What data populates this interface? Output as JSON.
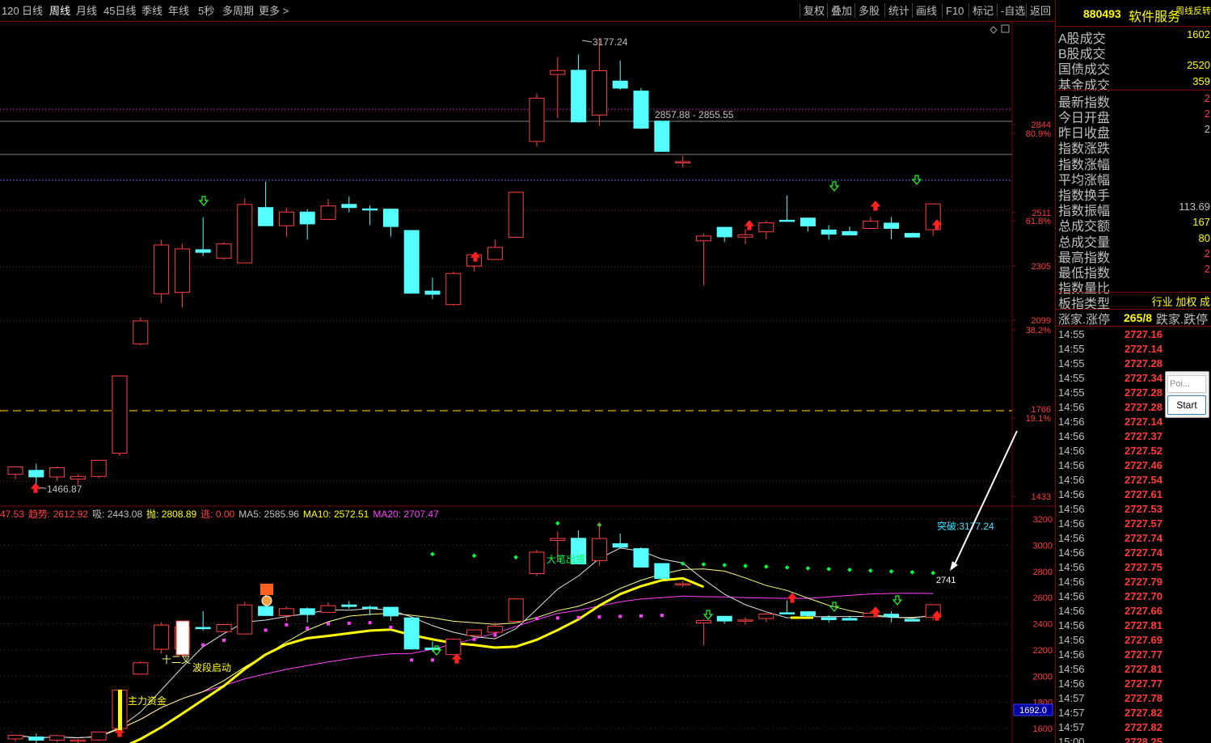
{
  "toolbar": {
    "left": [
      "120",
      "日线",
      "周线",
      "月线",
      "45日线",
      "季线",
      "年线",
      "5秒",
      "多周期",
      "更多 >"
    ],
    "active": "周线",
    "right": [
      "复权",
      "叠加",
      "多股",
      "统计",
      "画线",
      "F10",
      "标记",
      "-自选",
      "返回"
    ]
  },
  "price_axis": {
    "labels": [
      "2844",
      "80.9%",
      "2511",
      "61.8%",
      "2305",
      "2099",
      "38.2%",
      "1766",
      "19.1%",
      "1433"
    ]
  },
  "annotations": {
    "high": "3177.24",
    "low": "1466.87",
    "range_line": "2857.88 - 2855.55"
  },
  "indicator": {
    "legend": [
      {
        "text": "47.53",
        "color": "#ff4040"
      },
      {
        "text": "趋势: 2612.92",
        "color": "#ff4040"
      },
      {
        "text": "吸: 2443.08",
        "color": "#c0c0c0"
      },
      {
        "text": "抛: 2808.89",
        "color": "#ffff00"
      },
      {
        "text": "逃: 0.00",
        "color": "#ff4040"
      },
      {
        "text": "MA5: 2585.96",
        "color": "#c0c0c0"
      },
      {
        "text": "MA10: 2572.51",
        "color": "#ffff00"
      },
      {
        "text": "MA20: 2707.47",
        "color": "#ff40ff"
      }
    ],
    "axis": [
      "3200",
      "3000",
      "2800",
      "2600",
      "2400",
      "2200",
      "2000",
      "1800",
      "1600"
    ],
    "current_value": "1692.0",
    "labels": {
      "breakout": "突破:3177.24",
      "big_order": "大笔出货",
      "main_fund": "主力资金",
      "wave_start": "波段启动",
      "cross": "十二叉",
      "last_value": "2741"
    }
  },
  "panel": {
    "code": "880493",
    "name": "软件服务",
    "subtitle": "周线反转",
    "rows": [
      {
        "label": "A股成交",
        "value": "1602",
        "color": "#ffff00"
      },
      {
        "label": "B股成交",
        "value": "",
        "color": "#ffff00"
      },
      {
        "label": "国债成交",
        "value": "2520",
        "color": "#ffff00"
      },
      {
        "label": "基金成交",
        "value": "359",
        "color": "#ffff00"
      },
      {
        "label": "最新指数",
        "value": "2",
        "color": "#ff3c3c"
      },
      {
        "label": "今日开盘",
        "value": "2",
        "color": "#ff3c3c"
      },
      {
        "label": "昨日收盘",
        "value": "2",
        "color": "#c0c0c0"
      },
      {
        "label": "指数涨跌",
        "value": "",
        "color": "#ff3c3c"
      },
      {
        "label": "指数涨幅",
        "value": "",
        "color": "#ff3c3c"
      },
      {
        "label": "平均涨幅",
        "value": "",
        "color": "#ff3c3c"
      },
      {
        "label": "指数换手",
        "value": "",
        "color": "#ffff00"
      },
      {
        "label": "指数振幅",
        "value": "113.69",
        "color": "#c0c0c0"
      },
      {
        "label": "总成交额",
        "value": "167",
        "color": "#ffff00"
      },
      {
        "label": "总成交量",
        "value": "80",
        "color": "#ffff00"
      },
      {
        "label": "最高指数",
        "value": "2",
        "color": "#ff3c3c"
      },
      {
        "label": "最低指数",
        "value": "2",
        "color": "#ff3c3c"
      },
      {
        "label": "指数量比",
        "value": "",
        "color": "#ffff00"
      }
    ],
    "type_label": "板指类型",
    "type_value": "行业 加权 成",
    "updown_label_a": "涨家.涨停",
    "updown_value": "265/8",
    "updown_label_b": "跌家.跌停",
    "ticks": [
      {
        "time": "14:55",
        "price": "2727.16"
      },
      {
        "time": "14:55",
        "price": "2727.14"
      },
      {
        "time": "14:55",
        "price": "2727.28"
      },
      {
        "time": "14:55",
        "price": "2727.34"
      },
      {
        "time": "14:55",
        "price": "2727.28"
      },
      {
        "time": "14:56",
        "price": "2727.28"
      },
      {
        "time": "14:56",
        "price": "2727.14"
      },
      {
        "time": "14:56",
        "price": "2727.37"
      },
      {
        "time": "14:56",
        "price": "2727.52"
      },
      {
        "time": "14:56",
        "price": "2727.46"
      },
      {
        "time": "14:56",
        "price": "2727.54"
      },
      {
        "time": "14:56",
        "price": "2727.61"
      },
      {
        "time": "14:56",
        "price": "2727.53"
      },
      {
        "time": "14:56",
        "price": "2727.57"
      },
      {
        "time": "14:56",
        "price": "2727.74"
      },
      {
        "time": "14:56",
        "price": "2727.74"
      },
      {
        "time": "14:56",
        "price": "2727.75"
      },
      {
        "time": "14:56",
        "price": "2727.79"
      },
      {
        "time": "14:56",
        "price": "2727.70"
      },
      {
        "time": "14:56",
        "price": "2727.66"
      },
      {
        "time": "14:56",
        "price": "2727.81"
      },
      {
        "time": "14:56",
        "price": "2727.69"
      },
      {
        "time": "14:56",
        "price": "2727.77"
      },
      {
        "time": "14:56",
        "price": "2727.81"
      },
      {
        "time": "14:56",
        "price": "2727.77"
      },
      {
        "time": "14:57",
        "price": "2727.78"
      },
      {
        "time": "14:57",
        "price": "2727.82"
      },
      {
        "time": "14:57",
        "price": "2727.82"
      },
      {
        "time": "15:00",
        "price": "2728.25"
      }
    ]
  },
  "popup": {
    "input_placeholder": "Poi...",
    "button": "Start"
  },
  "chart_data": {
    "type": "candlestick",
    "period": "weekly",
    "price_range": [
      1433,
      3177.24
    ],
    "candles": [
      {
        "o": 1520,
        "h": 1545,
        "l": 1500,
        "c": 1548
      },
      {
        "o": 1535,
        "h": 1560,
        "l": 1467,
        "c": 1510
      },
      {
        "o": 1510,
        "h": 1550,
        "l": 1495,
        "c": 1545
      },
      {
        "o": 1502,
        "h": 1520,
        "l": 1480,
        "c": 1512
      },
      {
        "o": 1512,
        "h": 1575,
        "l": 1505,
        "c": 1573
      },
      {
        "o": 1600,
        "h": 1895,
        "l": 1590,
        "c": 1893
      },
      {
        "o": 2015,
        "h": 2115,
        "l": 2010,
        "c": 2102
      },
      {
        "o": 2205,
        "h": 2410,
        "l": 2170,
        "c": 2390
      },
      {
        "o": 2210,
        "h": 2395,
        "l": 2152,
        "c": 2375
      },
      {
        "o": 2372,
        "h": 2495,
        "l": 2348,
        "c": 2362
      },
      {
        "o": 2340,
        "h": 2400,
        "l": 2335,
        "c": 2394
      },
      {
        "o": 2322,
        "h": 2568,
        "l": 2322,
        "c": 2544
      },
      {
        "o": 2532,
        "h": 2630,
        "l": 2532,
        "c": 2463
      },
      {
        "o": 2463,
        "h": 2532,
        "l": 2420,
        "c": 2515
      },
      {
        "o": 2515,
        "h": 2525,
        "l": 2410,
        "c": 2470
      },
      {
        "o": 2487,
        "h": 2565,
        "l": 2485,
        "c": 2538
      },
      {
        "o": 2544,
        "h": 2574,
        "l": 2514,
        "c": 2532
      },
      {
        "o": 2527,
        "h": 2540,
        "l": 2465,
        "c": 2523
      },
      {
        "o": 2526,
        "h": 2490,
        "l": 2422,
        "c": 2460
      },
      {
        "o": 2445,
        "h": 2425,
        "l": 2213,
        "c": 2207
      },
      {
        "o": 2215,
        "h": 2266,
        "l": 2185,
        "c": 2203
      },
      {
        "o": 2164,
        "h": 2288,
        "l": 2160,
        "c": 2282
      },
      {
        "o": 2310,
        "h": 2334,
        "l": 2290,
        "c": 2353
      },
      {
        "o": 2335,
        "h": 2409,
        "l": 2333,
        "c": 2381
      },
      {
        "o": 2419,
        "h": 2590,
        "l": 2417,
        "c": 2590
      },
      {
        "o": 2783,
        "h": 2965,
        "l": 2764,
        "c": 2947
      },
      {
        "o": 3037,
        "h": 3103,
        "l": 2872,
        "c": 3052
      },
      {
        "o": 3053,
        "h": 3113,
        "l": 2854,
        "c": 2857
      },
      {
        "o": 2883,
        "h": 3177,
        "l": 2842,
        "c": 3051
      },
      {
        "o": 3012,
        "h": 3090,
        "l": 2979,
        "c": 2985
      },
      {
        "o": 2974,
        "h": 2985,
        "l": 2830,
        "c": 2833
      },
      {
        "o": 2860,
        "h": 2860,
        "l": 2744,
        "c": 2745
      },
      {
        "o": 2706,
        "h": 2727,
        "l": 2683,
        "c": 2706
      },
      {
        "o": 2406,
        "h": 2434,
        "l": 2236,
        "c": 2424
      },
      {
        "o": 2457,
        "h": 2440,
        "l": 2401,
        "c": 2421
      },
      {
        "o": 2420,
        "h": 2450,
        "l": 2393,
        "c": 2429
      },
      {
        "o": 2440,
        "h": 2481,
        "l": 2411,
        "c": 2474
      },
      {
        "o": 2484,
        "h": 2578,
        "l": 2487,
        "c": 2480
      },
      {
        "o": 2492,
        "h": 2480,
        "l": 2441,
        "c": 2462
      },
      {
        "o": 2447,
        "h": 2465,
        "l": 2410,
        "c": 2431
      },
      {
        "o": 2441,
        "h": 2460,
        "l": 2426,
        "c": 2428
      },
      {
        "o": 2453,
        "h": 2496,
        "l": 2453,
        "c": 2480
      },
      {
        "o": 2473,
        "h": 2496,
        "l": 2411,
        "c": 2453
      },
      {
        "o": 2434,
        "h": 2437,
        "l": 2421,
        "c": 2420
      },
      {
        "o": 2448,
        "h": 2543,
        "l": 2425,
        "c": 2546
      }
    ]
  }
}
